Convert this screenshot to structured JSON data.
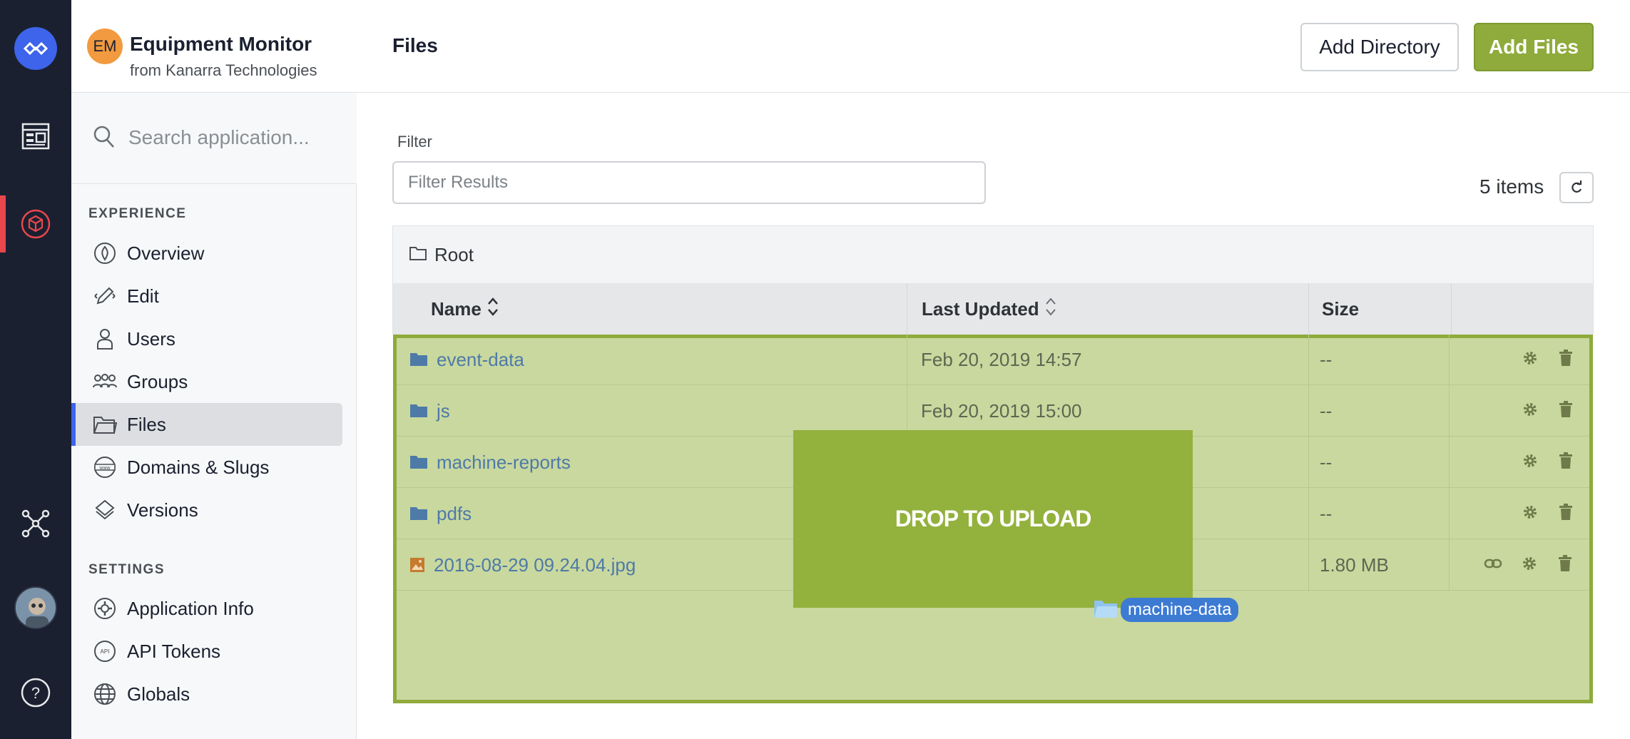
{
  "app": {
    "initials": "EM",
    "name": "Equipment Monitor",
    "subtitle": "from Kanarra Technologies"
  },
  "search": {
    "placeholder": "Search application..."
  },
  "sidebar": {
    "experience_title": "EXPERIENCE",
    "settings_title": "SETTINGS",
    "experience_items": [
      {
        "label": "Overview",
        "icon": "overview-icon"
      },
      {
        "label": "Edit",
        "icon": "edit-icon"
      },
      {
        "label": "Users",
        "icon": "users-icon"
      },
      {
        "label": "Groups",
        "icon": "groups-icon"
      },
      {
        "label": "Files",
        "icon": "folder-icon",
        "active": true
      },
      {
        "label": "Domains & Slugs",
        "icon": "globe-www-icon"
      },
      {
        "label": "Versions",
        "icon": "versions-icon"
      }
    ],
    "settings_items": [
      {
        "label": "Application Info",
        "icon": "gear-icon"
      },
      {
        "label": "API Tokens",
        "icon": "api-icon"
      },
      {
        "label": "Globals",
        "icon": "globe-icon"
      }
    ]
  },
  "header": {
    "title": "Files",
    "add_directory": "Add Directory",
    "add_files": "Add Files"
  },
  "filter": {
    "label": "Filter",
    "placeholder": "Filter Results",
    "value": ""
  },
  "items_count": "5 items",
  "breadcrumb": "Root",
  "table": {
    "columns": [
      "Name",
      "Last Updated",
      "Size"
    ],
    "rows": [
      {
        "name": "event-data",
        "type": "folder",
        "updated": "Feb 20, 2019 14:57",
        "size": "--"
      },
      {
        "name": "js",
        "type": "folder",
        "updated": "Feb 20, 2019 15:00",
        "size": "--"
      },
      {
        "name": "machine-reports",
        "type": "folder",
        "updated": "",
        "size": "--"
      },
      {
        "name": "pdfs",
        "type": "folder",
        "updated": "",
        "size": "--"
      },
      {
        "name": "2016-08-29 09.24.04.jpg",
        "type": "image",
        "updated": "",
        "size": "1.80 MB"
      }
    ]
  },
  "drop_overlay": {
    "text": "DROP TO UPLOAD"
  },
  "drag_item": {
    "label": "machine-data"
  },
  "colors": {
    "accent_green": "#8eab3b",
    "rail_dark": "#1b2030",
    "brand_blue": "#3d64ea",
    "active_red": "#e8474c",
    "app_badge": "#f29a3f"
  }
}
